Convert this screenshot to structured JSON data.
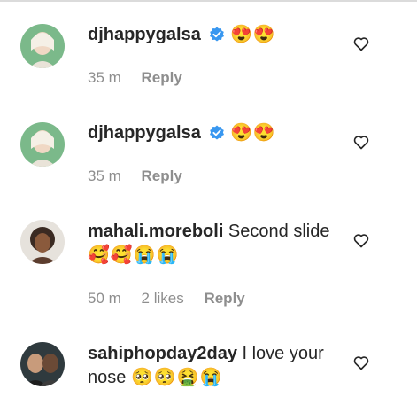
{
  "comments": [
    {
      "username": "djhappygalsa",
      "verified": true,
      "text": "",
      "emojis": "😍😍",
      "time": "35 m",
      "likes": "",
      "reply_label": "Reply"
    },
    {
      "username": "djhappygalsa",
      "verified": true,
      "text": "",
      "emojis": "😍😍",
      "time": "35 m",
      "likes": "",
      "reply_label": "Reply"
    },
    {
      "username": "mahali.moreboli",
      "verified": false,
      "text": " Second slide ",
      "emojis": "🥰🥰😭😭",
      "time": "50 m",
      "likes": "2 likes",
      "reply_label": "Reply"
    },
    {
      "username": "sahiphopday2day",
      "verified": false,
      "text": " I love your nose ",
      "emojis": "🥺🥺🤮😭",
      "time": "",
      "likes": "",
      "reply_label": ""
    }
  ],
  "colors": {
    "verified_badge": "#3897f0",
    "avatar_bg_green": "#7bb98a",
    "secondary_text": "#8e8e8e"
  },
  "icons": {
    "like": "heart-outline-icon",
    "verified": "verified-badge-icon"
  }
}
